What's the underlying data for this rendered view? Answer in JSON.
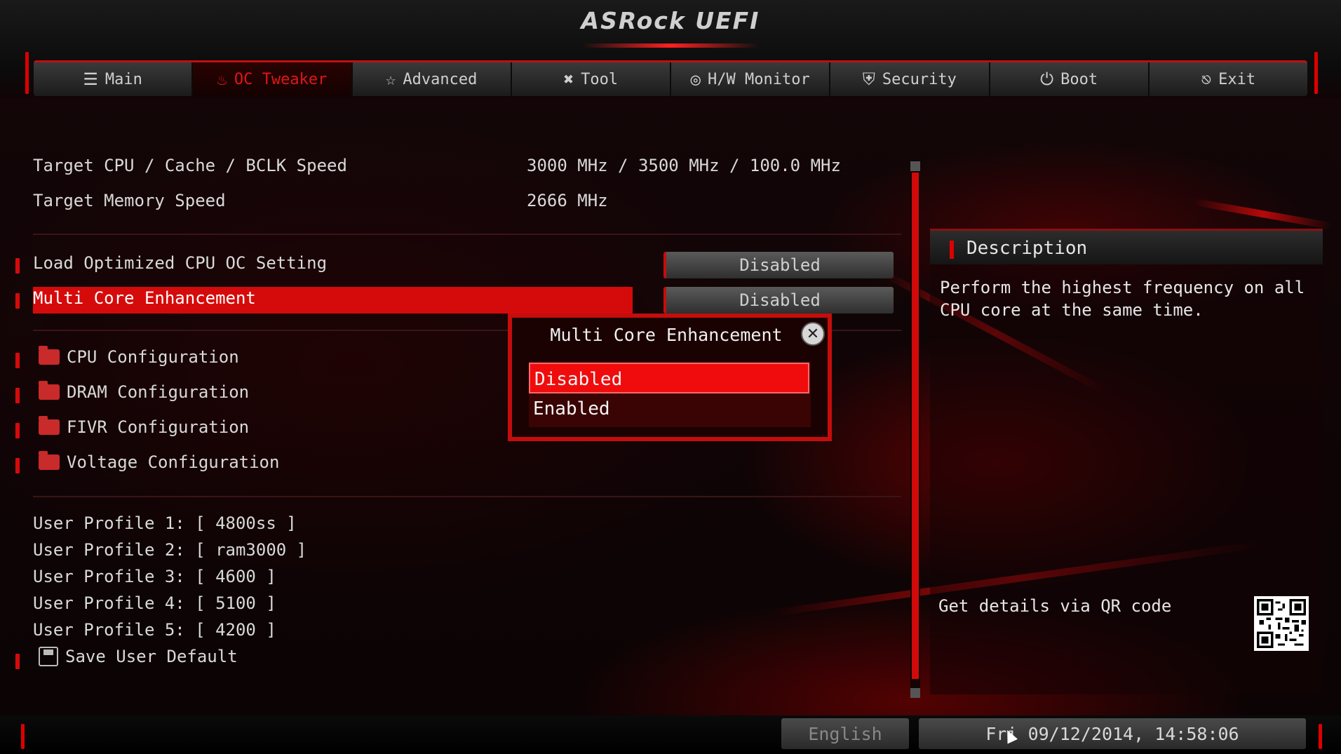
{
  "app": {
    "logo": "ASRock UEFI"
  },
  "tabs": [
    {
      "label": "Main",
      "icon": "list-icon",
      "glyph": "☰",
      "active": false
    },
    {
      "label": "OC Tweaker",
      "icon": "flame-icon",
      "glyph": "♨",
      "active": true
    },
    {
      "label": "Advanced",
      "icon": "star-icon",
      "glyph": "☆",
      "active": false
    },
    {
      "label": "Tool",
      "icon": "tools-icon",
      "glyph": "✖",
      "active": false
    },
    {
      "label": "H/W Monitor",
      "icon": "monitor-icon",
      "glyph": "◎",
      "active": false
    },
    {
      "label": "Security",
      "icon": "shield-icon",
      "glyph": "⛨",
      "active": false
    },
    {
      "label": "Boot",
      "icon": "power-icon",
      "glyph": "⏻",
      "active": false
    },
    {
      "label": "Exit",
      "icon": "exit-icon",
      "glyph": "⎋",
      "active": false
    }
  ],
  "info": [
    {
      "label": "Target CPU / Cache / BCLK Speed",
      "value": "3000 MHz / 3500 MHz / 100.0 MHz"
    },
    {
      "label": "Target Memory Speed",
      "value": "2666 MHz"
    }
  ],
  "settings": [
    {
      "label": "Load Optimized CPU OC Setting",
      "value": "Disabled"
    },
    {
      "label": "Multi Core Enhancement",
      "value": "Disabled",
      "selected": true
    }
  ],
  "submenus": [
    "CPU Configuration",
    "DRAM Configuration",
    "FIVR Configuration",
    "Voltage Configuration"
  ],
  "profiles": [
    "User Profile 1: [ 4800ss ]",
    "User Profile 2: [ ram3000 ]",
    "User Profile 3: [ 4600 ]",
    "User Profile 4: [ 5100 ]",
    "User Profile 5: [ 4200 ]"
  ],
  "save_default": "Save User Default",
  "description": {
    "title": "Description",
    "text": "Perform the highest frequency on all CPU core at the same time.",
    "qr_label": "Get details via QR code"
  },
  "popup": {
    "title": "Multi Core Enhancement",
    "options": [
      "Disabled",
      "Enabled"
    ],
    "selected_option": "Disabled"
  },
  "footer": {
    "language": "English",
    "datetime": "Fri 09/12/2014, 14:58:06"
  },
  "colors": {
    "accent": "#d50b0b",
    "selected": "#f00c0c",
    "text": "#d9d9d9"
  }
}
